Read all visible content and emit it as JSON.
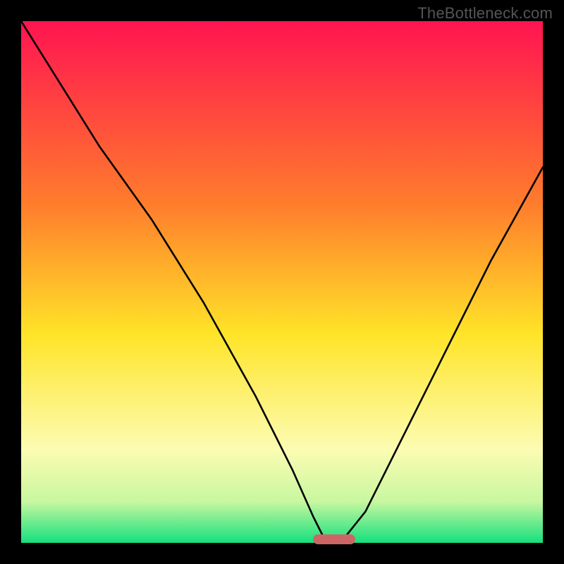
{
  "watermark": "TheBottleneck.com",
  "chart_data": {
    "type": "line",
    "title": "",
    "xlabel": "",
    "ylabel": "",
    "xlim": [
      0,
      100
    ],
    "ylim": [
      0,
      100
    ],
    "gradient_bg": [
      {
        "pos": 0,
        "color": "#ff1451"
      },
      {
        "pos": 35,
        "color": "#ff7c2c"
      },
      {
        "pos": 60,
        "color": "#ffe428"
      },
      {
        "pos": 82,
        "color": "#fcfcb2"
      },
      {
        "pos": 92,
        "color": "#c9f7a0"
      },
      {
        "pos": 100,
        "color": "#15e07d"
      }
    ],
    "curve": {
      "x": [
        0,
        5,
        15,
        25,
        35,
        45,
        52,
        56,
        58,
        60,
        62,
        66,
        72,
        80,
        90,
        100
      ],
      "y": [
        100,
        92,
        76,
        62,
        46,
        28,
        14,
        5,
        1,
        0,
        1,
        6,
        18,
        34,
        54,
        72
      ]
    },
    "optimal_marker": {
      "x_start": 56,
      "x_end": 64,
      "y": 0,
      "color": "#cc6666"
    }
  }
}
